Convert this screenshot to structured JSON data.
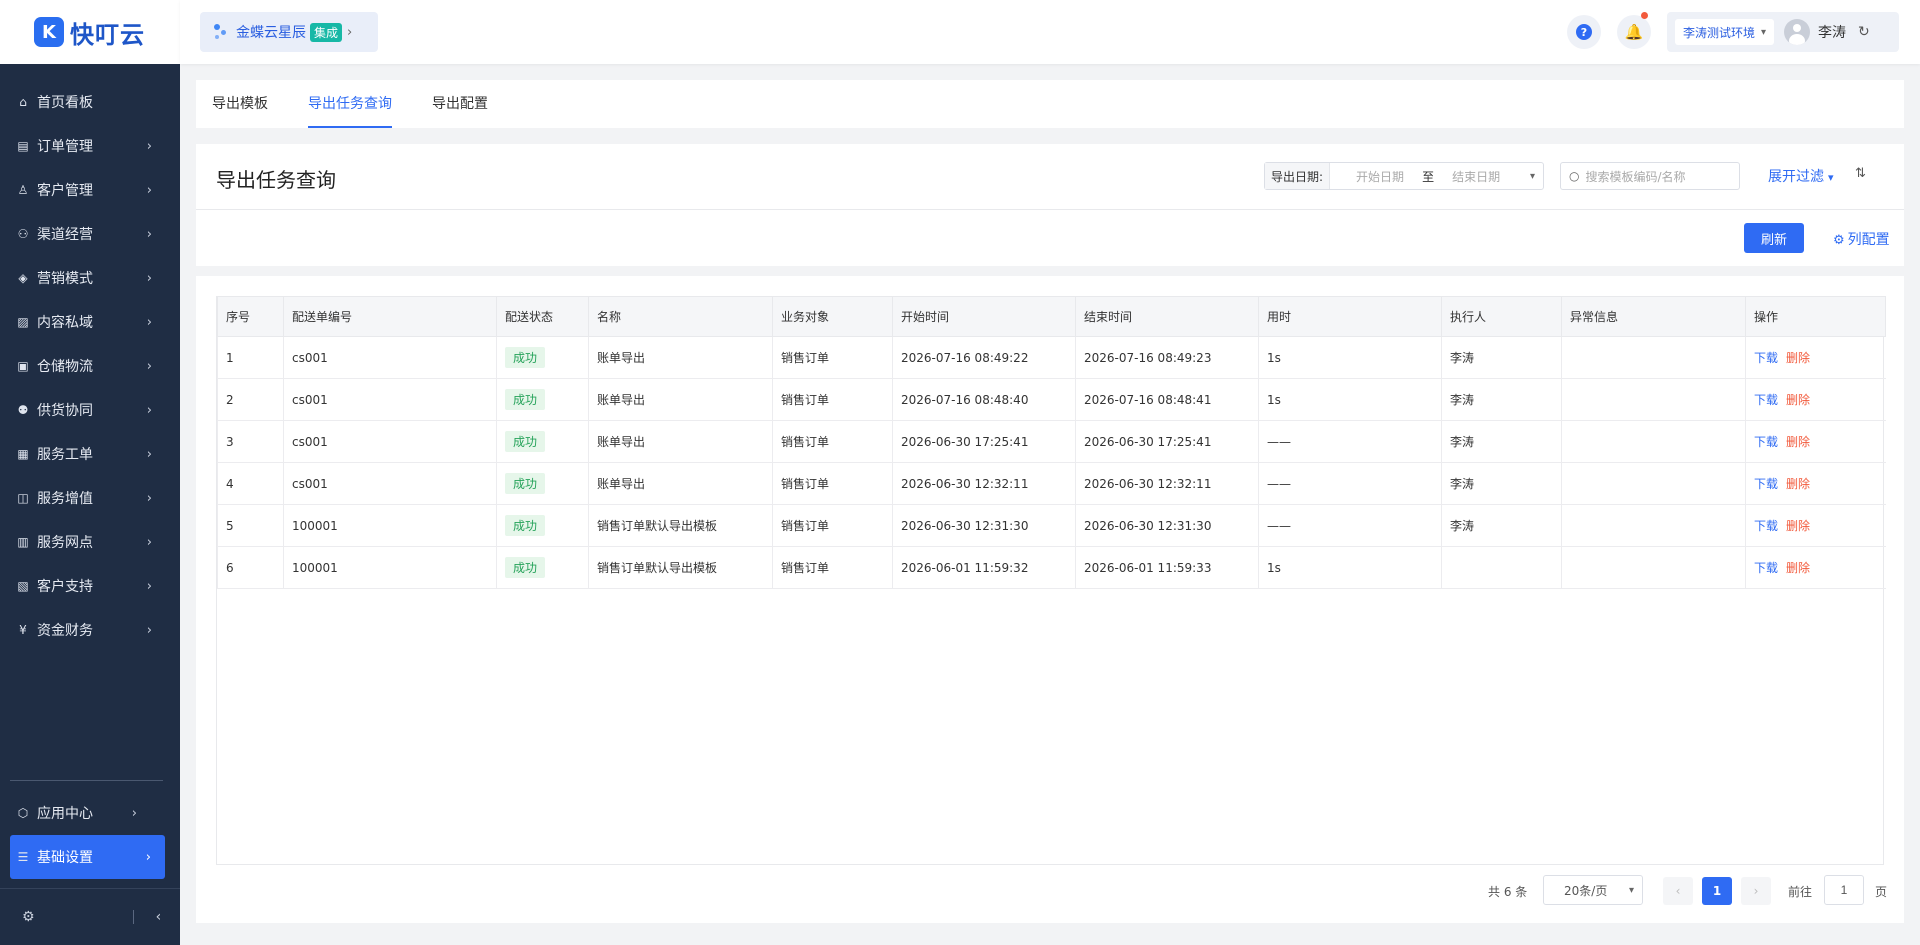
{
  "app": {
    "logo_text": "快叮云",
    "logo_mark": "K"
  },
  "sidebar": {
    "items": [
      {
        "label": "首页看板",
        "icon": "home-icon",
        "glyph": "⌂",
        "has_children": false
      },
      {
        "label": "订单管理",
        "icon": "clipboard-icon",
        "glyph": "▤",
        "has_children": true
      },
      {
        "label": "客户管理",
        "icon": "user-icon",
        "glyph": "♙",
        "has_children": true
      },
      {
        "label": "渠道经营",
        "icon": "channel-icon",
        "glyph": "⚇",
        "has_children": true
      },
      {
        "label": "营销模式",
        "icon": "tag-icon",
        "glyph": "◈",
        "has_children": true
      },
      {
        "label": "内容私域",
        "icon": "image-icon",
        "glyph": "▨",
        "has_children": true
      },
      {
        "label": "仓储物流",
        "icon": "warehouse-icon",
        "glyph": "▣",
        "has_children": true
      },
      {
        "label": "供货协同",
        "icon": "supply-icon",
        "glyph": "⚉",
        "has_children": true
      },
      {
        "label": "服务工单",
        "icon": "ticket-icon",
        "glyph": "▦",
        "has_children": true
      },
      {
        "label": "服务增值",
        "icon": "gift-icon",
        "glyph": "◫",
        "has_children": true
      },
      {
        "label": "服务网点",
        "icon": "store-icon",
        "glyph": "▥",
        "has_children": true
      },
      {
        "label": "客户支持",
        "icon": "support-icon",
        "glyph": "▧",
        "has_children": true
      },
      {
        "label": "资金财务",
        "icon": "yuan-icon",
        "glyph": "¥",
        "has_children": true
      }
    ],
    "bottom_items": [
      {
        "label": "应用中心",
        "icon": "cube-icon",
        "glyph": "⬡",
        "active": false
      },
      {
        "label": "基础设置",
        "icon": "settings-sliders-icon",
        "glyph": "☰",
        "active": true
      }
    ],
    "chevron": "›",
    "collapse_glyph": "‹",
    "footer_gear": "⚙"
  },
  "header": {
    "product_chip": {
      "name": "金蝶云星辰",
      "badge": "集成",
      "arrow": "›"
    },
    "help_glyph": "?",
    "bell_glyph": "🔔",
    "environment": "李涛测试环境",
    "user_name": "李涛",
    "refresh_glyph": "↻"
  },
  "tabs": [
    {
      "label": "导出模板",
      "active": false
    },
    {
      "label": "导出任务查询",
      "active": true
    },
    {
      "label": "导出配置",
      "active": false
    }
  ],
  "toolbar": {
    "title": "导出任务查询",
    "date_label": "导出日期:",
    "date_start_placeholder": "开始日期",
    "date_separator": "至",
    "date_end_placeholder": "结束日期",
    "search_placeholder": "搜索模板编码/名称",
    "expand_filter": "展开过滤",
    "refresh_button": "刷新",
    "column_config": "列配置"
  },
  "table": {
    "columns": [
      "序号",
      "配送单编号",
      "配送状态",
      "名称",
      "业务对象",
      "开始时间",
      "结束时间",
      "用时",
      "执行人",
      "异常信息",
      "操作"
    ],
    "rows": [
      {
        "index": "1",
        "code": "cs001",
        "status": "成功",
        "name": "账单导出",
        "object": "销售订单",
        "start": "2026-07-16 08:49:22",
        "end": "2026-07-16 08:49:23",
        "duration": "1s",
        "operator": "李涛",
        "error": ""
      },
      {
        "index": "2",
        "code": "cs001",
        "status": "成功",
        "name": "账单导出",
        "object": "销售订单",
        "start": "2026-07-16 08:48:40",
        "end": "2026-07-16 08:48:41",
        "duration": "1s",
        "operator": "李涛",
        "error": ""
      },
      {
        "index": "3",
        "code": "cs001",
        "status": "成功",
        "name": "账单导出",
        "object": "销售订单",
        "start": "2026-06-30 17:25:41",
        "end": "2026-06-30 17:25:41",
        "duration": "——",
        "operator": "李涛",
        "error": ""
      },
      {
        "index": "4",
        "code": "cs001",
        "status": "成功",
        "name": "账单导出",
        "object": "销售订单",
        "start": "2026-06-30 12:32:11",
        "end": "2026-06-30 12:32:11",
        "duration": "——",
        "operator": "李涛",
        "error": ""
      },
      {
        "index": "5",
        "code": "100001",
        "status": "成功",
        "name": "销售订单默认导出模板",
        "object": "销售订单",
        "start": "2026-06-30 12:31:30",
        "end": "2026-06-30 12:31:30",
        "duration": "——",
        "operator": "李涛",
        "error": ""
      },
      {
        "index": "6",
        "code": "100001",
        "status": "成功",
        "name": "销售订单默认导出模板",
        "object": "销售订单",
        "start": "2026-06-01 11:59:32",
        "end": "2026-06-01 11:59:33",
        "duration": "1s",
        "operator": "",
        "error": ""
      }
    ],
    "op_download": "下载",
    "op_delete": "删除"
  },
  "pagination": {
    "total": "共 6 条",
    "page_size": "20条/页",
    "current_page": "1",
    "goto_label": "前往",
    "goto_value": "1",
    "page_suffix": "页",
    "prev_glyph": "‹",
    "next_glyph": "›"
  },
  "colors": {
    "primary": "#2f6bf3",
    "sidebar_bg": "#1f2d44",
    "success": "#26a35a",
    "danger": "#f25a3c",
    "badge_teal": "#17b8a6"
  }
}
